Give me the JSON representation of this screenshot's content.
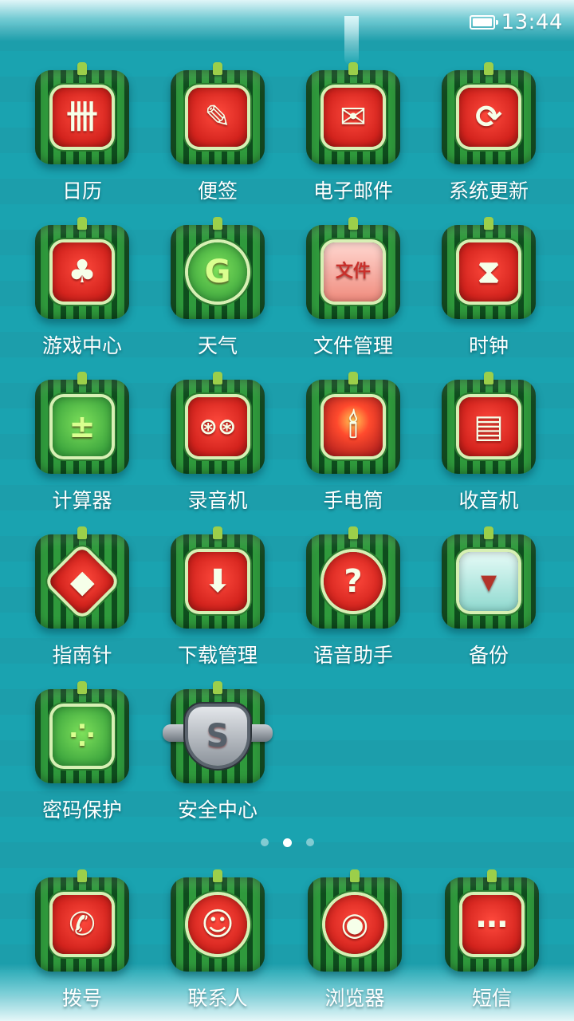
{
  "status_bar": {
    "time": "13:44",
    "battery_icon": "battery-full-icon"
  },
  "apps": [
    {
      "label": "日历",
      "icon": "calendar-icon",
      "glyph": "卌"
    },
    {
      "label": "便签",
      "icon": "notes-pencil-icon",
      "glyph": "✎"
    },
    {
      "label": "电子邮件",
      "icon": "email-envelope-icon",
      "glyph": "✉"
    },
    {
      "label": "系统更新",
      "icon": "system-update-arrow-icon",
      "glyph": "⟳"
    },
    {
      "label": "游戏中心",
      "icon": "club-suit-icon",
      "glyph": "♣"
    },
    {
      "label": "天气",
      "icon": "weather-sun-icon",
      "glyph": "G"
    },
    {
      "label": "文件管理",
      "icon": "file-folder-icon",
      "glyph": "文件"
    },
    {
      "label": "时钟",
      "icon": "hourglass-icon",
      "glyph": "⧗"
    },
    {
      "label": "计算器",
      "icon": "calculator-icon",
      "glyph": "±"
    },
    {
      "label": "录音机",
      "icon": "recorder-tape-icon",
      "glyph": "⊛⊛"
    },
    {
      "label": "手电筒",
      "icon": "flashlight-candle-icon",
      "glyph": "🕯"
    },
    {
      "label": "收音机",
      "icon": "radio-icon",
      "glyph": "▤"
    },
    {
      "label": "指南针",
      "icon": "compass-icon",
      "glyph": "◆"
    },
    {
      "label": "下载管理",
      "icon": "download-arrow-icon",
      "glyph": "⬇"
    },
    {
      "label": "语音助手",
      "icon": "voice-assistant-question-icon",
      "glyph": "?"
    },
    {
      "label": "备份",
      "icon": "backup-box-icon",
      "glyph": "▾"
    },
    {
      "label": "密码保护",
      "icon": "password-pattern-icon",
      "glyph": "⁘"
    },
    {
      "label": "安全中心",
      "icon": "security-shield-icon",
      "glyph": "S"
    }
  ],
  "pager": {
    "pages": 3,
    "active_index": 1
  },
  "dock": [
    {
      "label": "拨号",
      "icon": "phone-handset-icon",
      "glyph": "✆"
    },
    {
      "label": "联系人",
      "icon": "contacts-person-icon",
      "glyph": "☺"
    },
    {
      "label": "浏览器",
      "icon": "browser-planet-icon",
      "glyph": "◉"
    },
    {
      "label": "短信",
      "icon": "message-bubble-icon",
      "glyph": "⋯"
    }
  ]
}
